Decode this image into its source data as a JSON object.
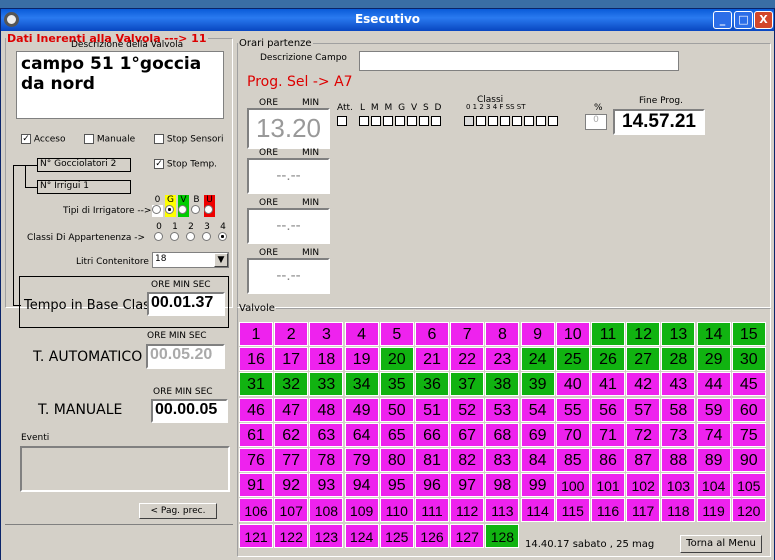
{
  "window": {
    "title": "Esecutivo",
    "min": "_",
    "max": "□",
    "close": "X"
  },
  "left": {
    "legend": "Dati Inerenti alla Valvola ---> 11",
    "desc_label": "Descrizione della Valvola",
    "desc_value": "campo 51 1°goccia da nord",
    "acceso": "Acceso",
    "manuale": "Manuale",
    "stop_sensori": "Stop Sensori",
    "stop_temp": "Stop Temp.",
    "gocciolatori": "N° Gocciolatori 2",
    "irrigui": "N° Irrigui  1",
    "tipi_label": "Tipi di Irrigatore -->",
    "tipi_opts": [
      "0",
      "G",
      "V",
      "B",
      "U"
    ],
    "classi_label": "Classi Di Appartenenza ->",
    "classi_opts": [
      "0",
      "1",
      "2",
      "3",
      "4"
    ],
    "litri_label": "Litri Contenitore",
    "litri_value": "18",
    "hdr": "ORE  MIN  SEC",
    "base_label": "Tempo in Base Classe",
    "base_value": "00.01.37",
    "auto_label": "T. AUTOMATICO",
    "auto_value": "00.05.20",
    "man_label": "T. MANUALE",
    "man_value": "00.00.05",
    "eventi": "Eventi",
    "prev": "< Pag. prec."
  },
  "orari": {
    "legend": "Orari partenze",
    "desc_campo": "Descrizione Campo",
    "prog": "Prog. Sel -> A7",
    "ore": "ORE",
    "min": "MIN",
    "t1": "13.20",
    "tblank": "--.--",
    "att": "Att.",
    "days": "L M M G V S D",
    "classi": "Classi",
    "classi_nums": "0  1  2  3  4  F  SS ST",
    "pct": "%",
    "pct_value": "0",
    "fine": "Fine Prog.",
    "fine_value": "14.57.21"
  },
  "valvole": {
    "legend": "Valvole",
    "green": [
      11,
      12,
      13,
      14,
      15,
      20,
      24,
      25,
      26,
      27,
      28,
      29,
      30,
      31,
      32,
      33,
      34,
      35,
      36,
      37,
      38,
      39,
      128
    ],
    "total": 128
  },
  "status": {
    "time": "14.40.17  sabato , 25 mag",
    "menu": "Torna al Menu"
  },
  "colors": {
    "active": "#11b311",
    "inactive": "#ee22ee"
  }
}
